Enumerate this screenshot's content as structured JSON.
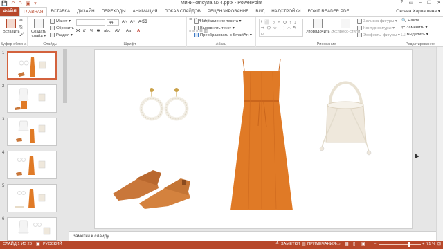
{
  "titlebar": {
    "title": "Мини-капсула № 4.pptx - PowerPoint",
    "qat": [
      "💾",
      "↶",
      "↷",
      "▣",
      "▾"
    ],
    "window_buttons": [
      "?",
      "▭",
      "–",
      "☐",
      "✕"
    ]
  },
  "tabs": {
    "file": "ФАЙЛ",
    "items": [
      "ГЛАВНАЯ",
      "ВСТАВКА",
      "ДИЗАЙН",
      "ПЕРЕХОДЫ",
      "АНИМАЦИЯ",
      "ПОКАЗ СЛАЙДОВ",
      "РЕЦЕНЗИРОВАНИЕ",
      "ВИД",
      "НАДСТРОЙКИ",
      "FOXIT READER PDF"
    ],
    "active_index": 0,
    "user": "Оксана Харлашина ▾"
  },
  "ribbon": {
    "clipboard": {
      "paste": "Вставить",
      "label": "Буфер обмена"
    },
    "slides": {
      "new_slide": "Создать слайд ▾",
      "layout": "Макет ▾",
      "reset": "Сбросить",
      "section": "Раздел ▾",
      "label": "Слайды"
    },
    "font": {
      "font_name": "",
      "font_size": "44",
      "bold": "Ж",
      "italic": "К",
      "underline": "Ч",
      "strike": "S",
      "shadow": "abc",
      "spacing": "AV",
      "case": "Aa",
      "color": "A",
      "label": "Шрифт"
    },
    "paragraph": {
      "text_direction": "Направление текста ▾",
      "align_text": "Выровнять текст ▾",
      "smartart": "Преобразовать в SmartArt ▾",
      "label": "Абзац"
    },
    "drawing": {
      "arrange": "Упорядочить",
      "quick_styles": "Экспресс-стили",
      "fill": "Заливка фигуры ▾",
      "outline": "Контур фигуры ▾",
      "effects": "Эффекты фигуры ▾",
      "label": "Рисование"
    },
    "editing": {
      "find": "Найти",
      "replace": "Заменить ▾",
      "select": "Выделить ▾",
      "label": "Редактирование"
    },
    "shapes_gallery": "\\ ⬜ ○ △ ⬭ ↑ ↓ ⇨ ⬠ ☆ { } ⌒ ✎ ▱"
  },
  "thumbnails": [
    {
      "num": "1",
      "selected": true
    },
    {
      "num": "2",
      "selected": false
    },
    {
      "num": "3",
      "selected": false
    },
    {
      "num": "4",
      "selected": false
    },
    {
      "num": "5",
      "selected": false
    },
    {
      "num": "6",
      "selected": false
    }
  ],
  "notes": {
    "placeholder": "Заметки к слайду"
  },
  "status": {
    "slide_info": "СЛАЙД 1 ИЗ 20",
    "language": "РУССКИЙ",
    "notes": "ЗАМЕТКИ",
    "comments": "ПРИМЕЧАНИЯ",
    "zoom": "71 %",
    "zoom_fraction": 0.71
  },
  "colors": {
    "accent": "#b7472a",
    "dress": "#e07a26",
    "shoes": "#c9773a",
    "bag": "#efe8dc"
  },
  "slide_items": [
    "pearl-hoop-earrings",
    "orange-dress",
    "bucket-bag",
    "tan-mules"
  ]
}
